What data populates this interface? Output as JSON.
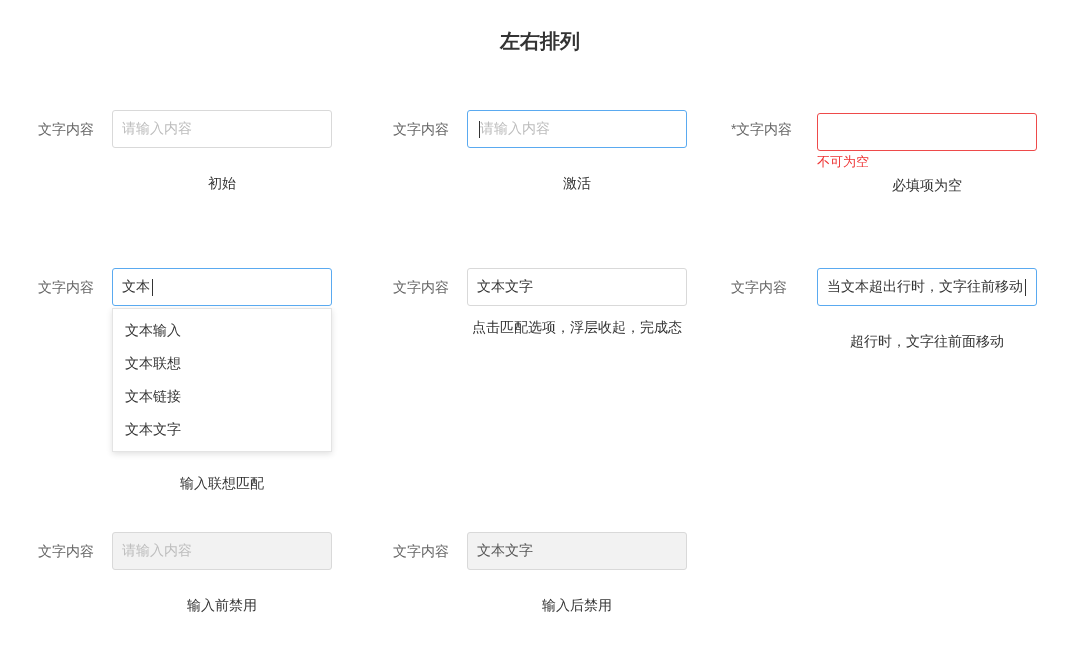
{
  "title": "左右排列",
  "rows": [
    {
      "cells": [
        {
          "label": "文字内容",
          "focused": false,
          "invalid": false,
          "disabled": false,
          "placeholder": "请输入内容",
          "cursor": false,
          "caption": "初始"
        },
        {
          "label": "文字内容",
          "focused": true,
          "invalid": false,
          "disabled": false,
          "placeholder": "请输入内容",
          "cursor": true,
          "caption": "激活"
        },
        {
          "label": "*文字内容",
          "focused": false,
          "invalid": true,
          "disabled": false,
          "cursor": false,
          "error": "不可为空",
          "caption": "必填项为空"
        }
      ]
    },
    {
      "cells": [
        {
          "label": "文字内容",
          "focused": true,
          "invalid": false,
          "disabled": false,
          "value": "文本",
          "cursor": true,
          "suggestions": [
            "文本输入",
            "文本联想",
            "文本链接",
            "文本文字"
          ],
          "caption": "输入联想匹配"
        },
        {
          "label": "文字内容",
          "focused": false,
          "invalid": false,
          "disabled": false,
          "value": "文本文字",
          "cursor": false,
          "caption": "点击匹配选项，浮层收起，完成态"
        },
        {
          "label": "文字内容",
          "focused": true,
          "invalid": false,
          "disabled": false,
          "value": "当文本超出行时，文字往前移动",
          "cursor": true,
          "caption": "超行时，文字往前面移动"
        }
      ]
    },
    {
      "cells": [
        {
          "label": "文字内容",
          "focused": false,
          "invalid": false,
          "disabled": true,
          "placeholder": "请输入内容",
          "cursor": false,
          "caption": "输入前禁用"
        },
        {
          "label": "文字内容",
          "focused": false,
          "invalid": false,
          "disabled": true,
          "value": "文本文字",
          "cursor": false,
          "caption": "输入后禁用"
        }
      ]
    }
  ]
}
